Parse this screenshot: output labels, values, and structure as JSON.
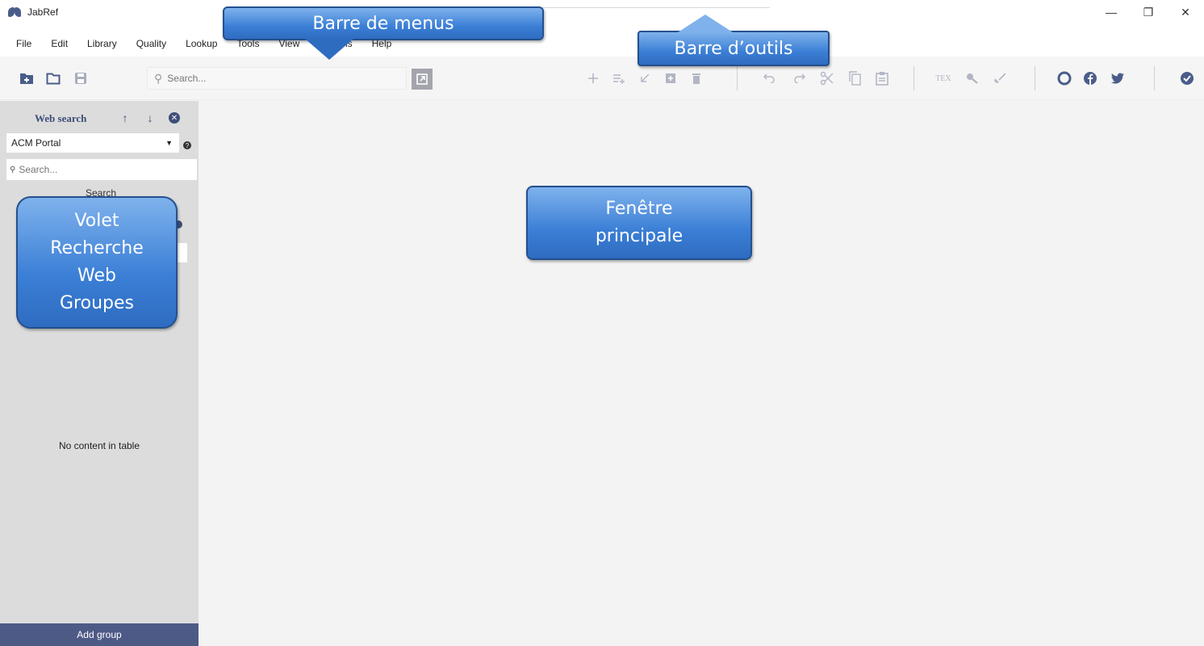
{
  "window": {
    "title": "JabRef",
    "controls": [
      "—",
      "❐",
      "✕"
    ]
  },
  "menu": {
    "items": [
      "File",
      "Edit",
      "Library",
      "Quality",
      "Lookup",
      "Tools",
      "View",
      "Options",
      "Help"
    ]
  },
  "toolbar": {
    "search_placeholder": "Search...",
    "left_icons": [
      "new-library-icon",
      "open-library-icon",
      "save-library-icon"
    ],
    "entry_icons": [
      "add-entry-icon",
      "add-entry-from-text-icon",
      "import-entry-icon",
      "add-entry-plus-icon",
      "delete-entry-icon"
    ],
    "edit_icons": [
      "undo-icon",
      "redo-icon",
      "cut-icon",
      "copy-icon",
      "paste-icon"
    ],
    "tool_icons": [
      "latex-icon",
      "key-icon",
      "cleanup-icon"
    ],
    "social_icons": [
      "github-icon",
      "facebook-icon",
      "twitter-icon"
    ],
    "status_icon": "check-circle-icon"
  },
  "sidepane": {
    "web_search_title": "Web search",
    "fetcher_selected": "ACM Portal",
    "search_placeholder": "Search...",
    "search_button": "Search",
    "no_content": "No content in table",
    "add_group": "Add group"
  },
  "callouts": {
    "menus": "Barre de menus",
    "tools": "Barre  d’outils",
    "volet": [
      "Volet",
      "Recherche",
      "Web",
      "Groupes"
    ],
    "fenetre": [
      "Fenêtre",
      "principale"
    ]
  },
  "colors": {
    "accent": "#4a5d8a",
    "muted_icon": "#b2b6c4",
    "sidepane_bg": "#dcdcdc",
    "add_group_bg": "#4e5a86",
    "callout_blue": "#3b7fd6"
  }
}
